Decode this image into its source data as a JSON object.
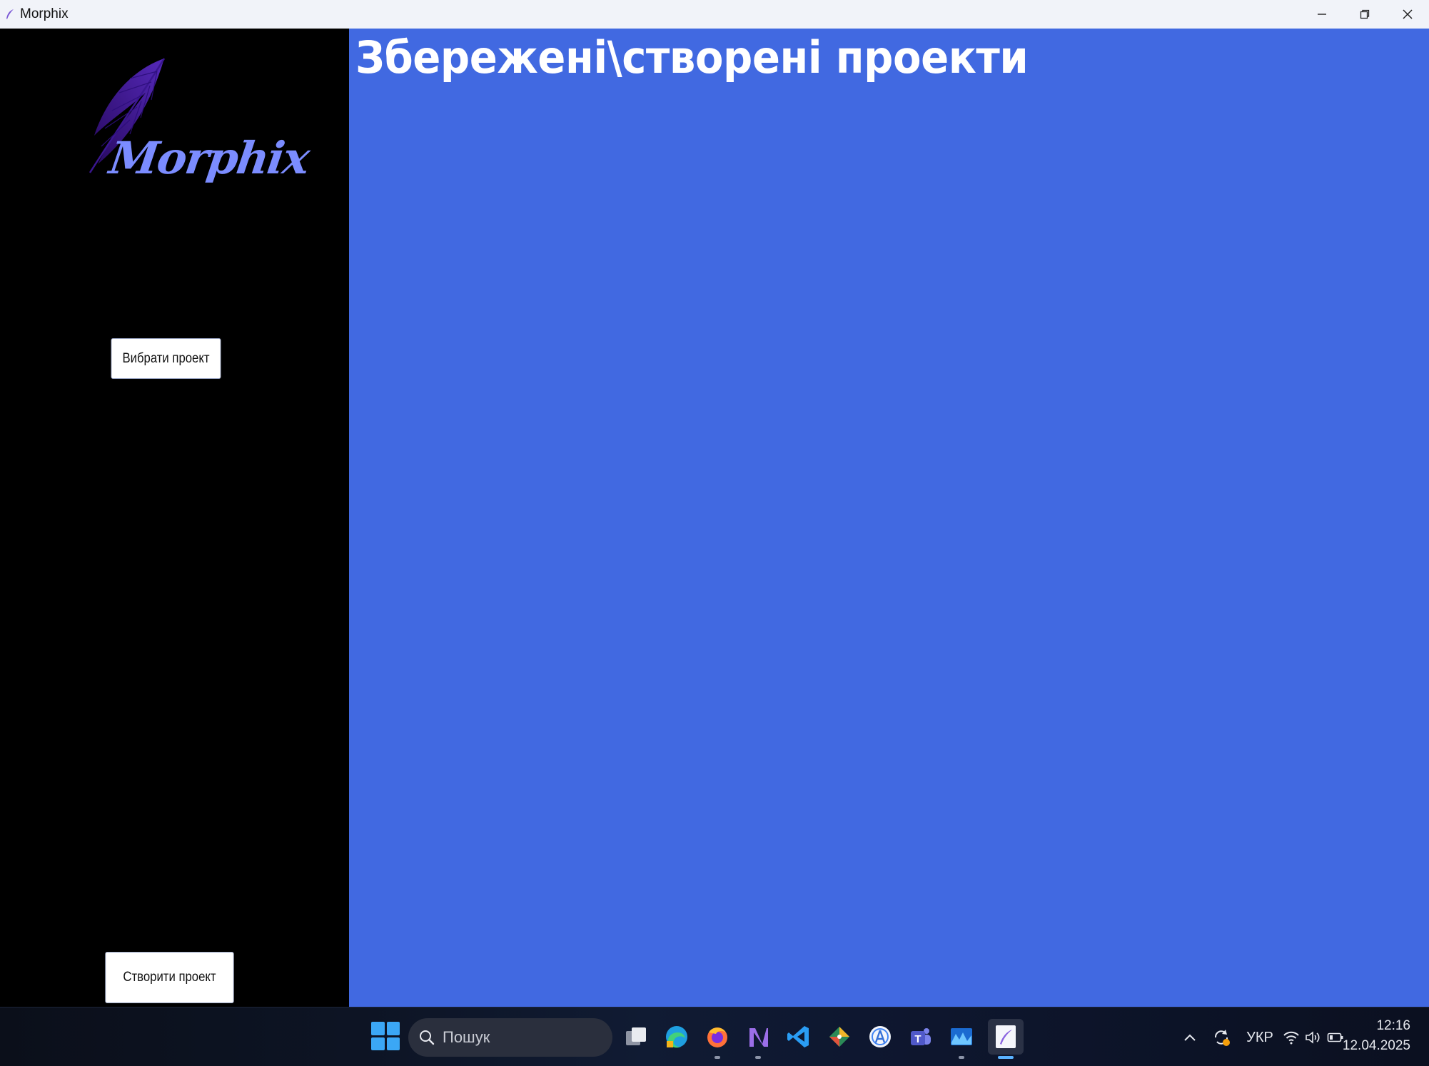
{
  "window": {
    "title": "Morphix",
    "controls": [
      "minimize-icon",
      "restore-icon",
      "close-icon"
    ]
  },
  "sidebar": {
    "logo_text": "Morphix",
    "select_project_label": "Вибрати проект",
    "create_project_label": "Створити проект"
  },
  "main": {
    "title": "Збережені\\створені проекти",
    "background_color": "#4169e1"
  },
  "taskbar": {
    "search_placeholder": "Пошук",
    "apps": [
      "task-view-icon",
      "edge-icon",
      "firefox-icon",
      "visual-studio-icon",
      "vscode-icon",
      "git-icon",
      "android-studio-icon",
      "teams-icon",
      "monitor-icon",
      "morphix-icon"
    ],
    "tray": {
      "language": "УКР",
      "time": "12:16",
      "date": "12.04.2025"
    }
  }
}
